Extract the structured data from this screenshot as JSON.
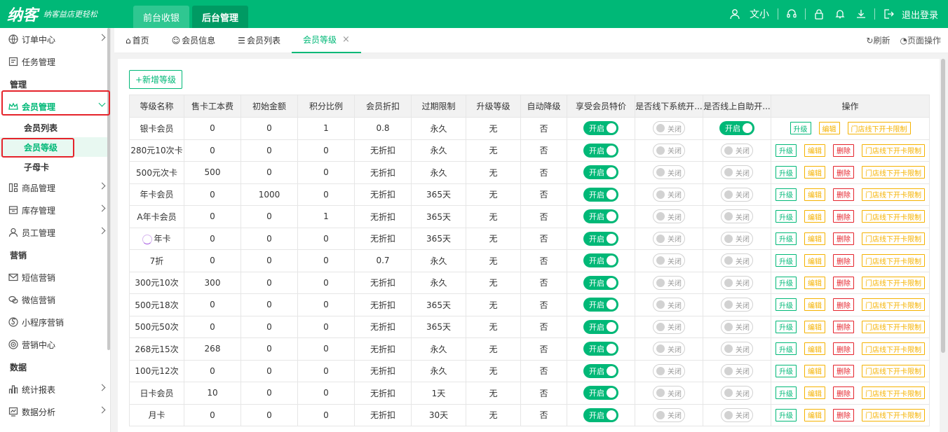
{
  "header": {
    "logo": "纳客",
    "slogan": "纳客益店更轻松",
    "nav": [
      {
        "label": "前台收银",
        "active": false
      },
      {
        "label": "后台管理",
        "active": true
      }
    ],
    "user": "文小",
    "logout": "退出登录"
  },
  "sidebar": {
    "items": [
      {
        "type": "item",
        "label": "订单中心",
        "icon": "globe-icon",
        "arrow": true
      },
      {
        "type": "item",
        "label": "任务管理",
        "icon": "task-icon",
        "arrow": false
      },
      {
        "type": "group",
        "label": "管理"
      },
      {
        "type": "item",
        "label": "会员管理",
        "icon": "crown-icon",
        "arrow": true,
        "open": true
      },
      {
        "type": "sub",
        "label": "会员列表"
      },
      {
        "type": "sub",
        "label": "会员等级",
        "active": true
      },
      {
        "type": "sub",
        "label": "子母卡"
      },
      {
        "type": "item",
        "label": "商品管理",
        "icon": "grid-icon",
        "arrow": true
      },
      {
        "type": "item",
        "label": "库存管理",
        "icon": "box-icon",
        "arrow": true
      },
      {
        "type": "item",
        "label": "员工管理",
        "icon": "user-icon",
        "arrow": true
      },
      {
        "type": "group",
        "label": "营销"
      },
      {
        "type": "item",
        "label": "短信营销",
        "icon": "mail-icon",
        "arrow": false
      },
      {
        "type": "item",
        "label": "微信营销",
        "icon": "wechat-icon",
        "arrow": false
      },
      {
        "type": "item",
        "label": "小程序营销",
        "icon": "miniapp-icon",
        "arrow": false
      },
      {
        "type": "item",
        "label": "营销中心",
        "icon": "target-icon",
        "arrow": false
      },
      {
        "type": "group",
        "label": "数据"
      },
      {
        "type": "item",
        "label": "统计报表",
        "icon": "bar-chart-icon",
        "arrow": true
      },
      {
        "type": "item",
        "label": "数据分析",
        "icon": "analysis-icon",
        "arrow": true
      }
    ]
  },
  "tabs": {
    "items": [
      {
        "label": "首页",
        "icon": "home-icon"
      },
      {
        "label": "会员信息",
        "icon": "user-icon"
      },
      {
        "label": "会员列表",
        "icon": "list-icon"
      },
      {
        "label": "会员等级",
        "active": true,
        "closable": true
      }
    ],
    "refresh": "刷新",
    "page_ops": "页面操作"
  },
  "toolbar": {
    "add_label": "+新增等级"
  },
  "table": {
    "columns": [
      "等级名称",
      "售卡工本费",
      "初始金额",
      "积分比例",
      "会员折扣",
      "过期限制",
      "升级等级",
      "自动降级",
      "享受会员特价",
      "是否线下系统开...",
      "是否线上自助开...",
      "操作"
    ],
    "labels": {
      "on": "开启",
      "off": "关闭",
      "upgrade": "升级",
      "edit": "编辑",
      "delete": "删除",
      "limit": "门店线下开卡限制"
    },
    "rows": [
      {
        "name": "银卡会员",
        "fee": "0",
        "init": "0",
        "ratio": "1",
        "discount": "0.8",
        "expire": "永久",
        "up": "无",
        "down": "否",
        "special": true,
        "offline": false,
        "online": true,
        "deletable": false
      },
      {
        "name": "280元10次卡",
        "fee": "0",
        "init": "0",
        "ratio": "0",
        "discount": "无折扣",
        "expire": "永久",
        "up": "无",
        "down": "否",
        "special": true,
        "offline": false,
        "online": false,
        "deletable": true
      },
      {
        "name": "500元次卡",
        "fee": "500",
        "init": "0",
        "ratio": "0",
        "discount": "无折扣",
        "expire": "永久",
        "up": "无",
        "down": "否",
        "special": true,
        "offline": false,
        "online": false,
        "deletable": true
      },
      {
        "name": "年卡会员",
        "fee": "0",
        "init": "1000",
        "ratio": "0",
        "discount": "无折扣",
        "expire": "365天",
        "up": "无",
        "down": "否",
        "special": true,
        "offline": false,
        "online": false,
        "deletable": true
      },
      {
        "name": "A年卡会员",
        "fee": "0",
        "init": "0",
        "ratio": "1",
        "discount": "无折扣",
        "expire": "365天",
        "up": "无",
        "down": "否",
        "special": true,
        "offline": false,
        "online": false,
        "deletable": true
      },
      {
        "name": "年卡",
        "fee": "0",
        "init": "0",
        "ratio": "0",
        "discount": "无折扣",
        "expire": "365天",
        "up": "无",
        "down": "否",
        "special": true,
        "offline": false,
        "online": false,
        "deletable": true,
        "loading": true
      },
      {
        "name": "7折",
        "fee": "0",
        "init": "0",
        "ratio": "0",
        "discount": "0.7",
        "expire": "永久",
        "up": "无",
        "down": "否",
        "special": true,
        "offline": false,
        "online": false,
        "deletable": true
      },
      {
        "name": "300元10次",
        "fee": "300",
        "init": "0",
        "ratio": "0",
        "discount": "无折扣",
        "expire": "永久",
        "up": "无",
        "down": "否",
        "special": true,
        "offline": false,
        "online": false,
        "deletable": true
      },
      {
        "name": "500元18次",
        "fee": "0",
        "init": "0",
        "ratio": "0",
        "discount": "无折扣",
        "expire": "365天",
        "up": "无",
        "down": "否",
        "special": true,
        "offline": false,
        "online": false,
        "deletable": true
      },
      {
        "name": "500元50次",
        "fee": "0",
        "init": "0",
        "ratio": "0",
        "discount": "无折扣",
        "expire": "365天",
        "up": "无",
        "down": "否",
        "special": true,
        "offline": false,
        "online": false,
        "deletable": true
      },
      {
        "name": "268元15次",
        "fee": "268",
        "init": "0",
        "ratio": "0",
        "discount": "无折扣",
        "expire": "永久",
        "up": "无",
        "down": "否",
        "special": true,
        "offline": false,
        "online": false,
        "deletable": true
      },
      {
        "name": "100元12次",
        "fee": "0",
        "init": "0",
        "ratio": "0",
        "discount": "无折扣",
        "expire": "永久",
        "up": "无",
        "down": "否",
        "special": true,
        "offline": false,
        "online": false,
        "deletable": true
      },
      {
        "name": "日卡会员",
        "fee": "10",
        "init": "0",
        "ratio": "0",
        "discount": "无折扣",
        "expire": "1天",
        "up": "无",
        "down": "否",
        "special": true,
        "offline": false,
        "online": false,
        "deletable": true
      },
      {
        "name": "月卡",
        "fee": "0",
        "init": "0",
        "ratio": "0",
        "discount": "无折扣",
        "expire": "30天",
        "up": "无",
        "down": "否",
        "special": true,
        "offline": false,
        "online": false,
        "deletable": true
      }
    ]
  },
  "colors": {
    "brand": "#00b877",
    "highlight": "#e5232b"
  }
}
